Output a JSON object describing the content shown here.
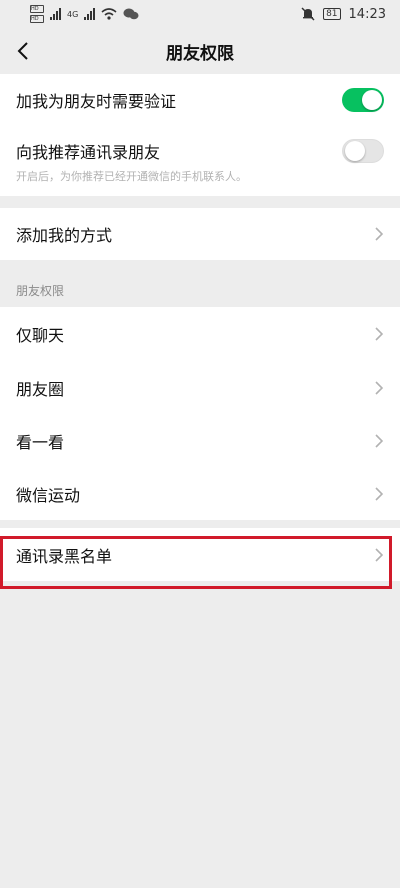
{
  "status_bar": {
    "sim_labels": [
      "HD",
      "HD"
    ],
    "network": "4G",
    "battery": "81",
    "time": "14:23"
  },
  "nav": {
    "title": "朋友权限"
  },
  "verification": {
    "label": "加我为朋友时需要验证",
    "enabled": true
  },
  "recommend": {
    "label": "向我推荐通讯录朋友",
    "enabled": false,
    "hint": "开启后，为你推荐已经开通微信的手机联系人。"
  },
  "add_methods": {
    "label": "添加我的方式"
  },
  "friend_permissions": {
    "header": "朋友权限",
    "items": [
      {
        "label": "仅聊天"
      },
      {
        "label": "朋友圈"
      },
      {
        "label": "看一看"
      },
      {
        "label": "微信运动"
      }
    ]
  },
  "blacklist": {
    "label": "通讯录黑名单"
  },
  "colors": {
    "toggle_on": "#07c160",
    "highlight": "#d11a2a",
    "background": "#ededed"
  }
}
